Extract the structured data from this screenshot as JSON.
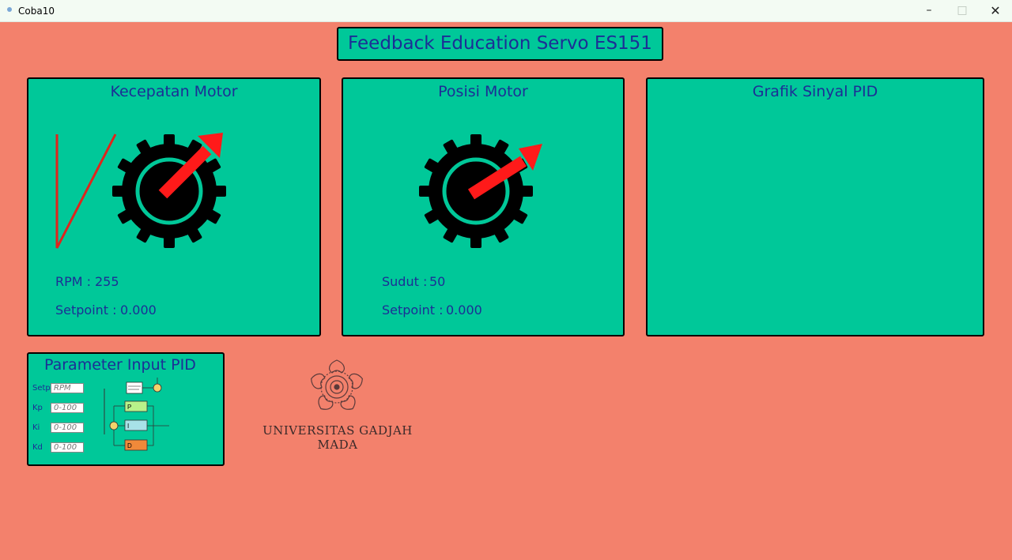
{
  "window": {
    "title": "Coba10",
    "minimize": "–",
    "maximize": "□",
    "close": "✕"
  },
  "header": {
    "title": "Feedback Education Servo ES151"
  },
  "speed_panel": {
    "title": "Kecepatan Motor",
    "rpm_label": "RPM :",
    "rpm_value": "255",
    "setpoint_label": "Setpoint :",
    "setpoint_value": "0.000"
  },
  "position_panel": {
    "title": "Posisi Motor",
    "angle_label": "Sudut :",
    "angle_value": "50",
    "setpoint_label": "Setpoint :",
    "setpoint_value": "0.000"
  },
  "graph_panel": {
    "title": "Grafik Sinyal PID"
  },
  "param_panel": {
    "title": "Parameter Input PID",
    "fields": [
      {
        "label": "Setp",
        "value": "RPM"
      },
      {
        "label": "Kp",
        "value": "0-100"
      },
      {
        "label": "Ki",
        "value": "0-100"
      },
      {
        "label": "Kd",
        "value": "0-100"
      }
    ],
    "diagram_blocks": [
      "P",
      "I",
      "D"
    ]
  },
  "logo": {
    "text": "UNIVERSITAS GADJAH MADA"
  },
  "colors": {
    "background": "#f3816c",
    "panel": "#00c899",
    "title_text": "#1c2e96",
    "arrow": "#ff1a1a",
    "gear": "#000000"
  }
}
